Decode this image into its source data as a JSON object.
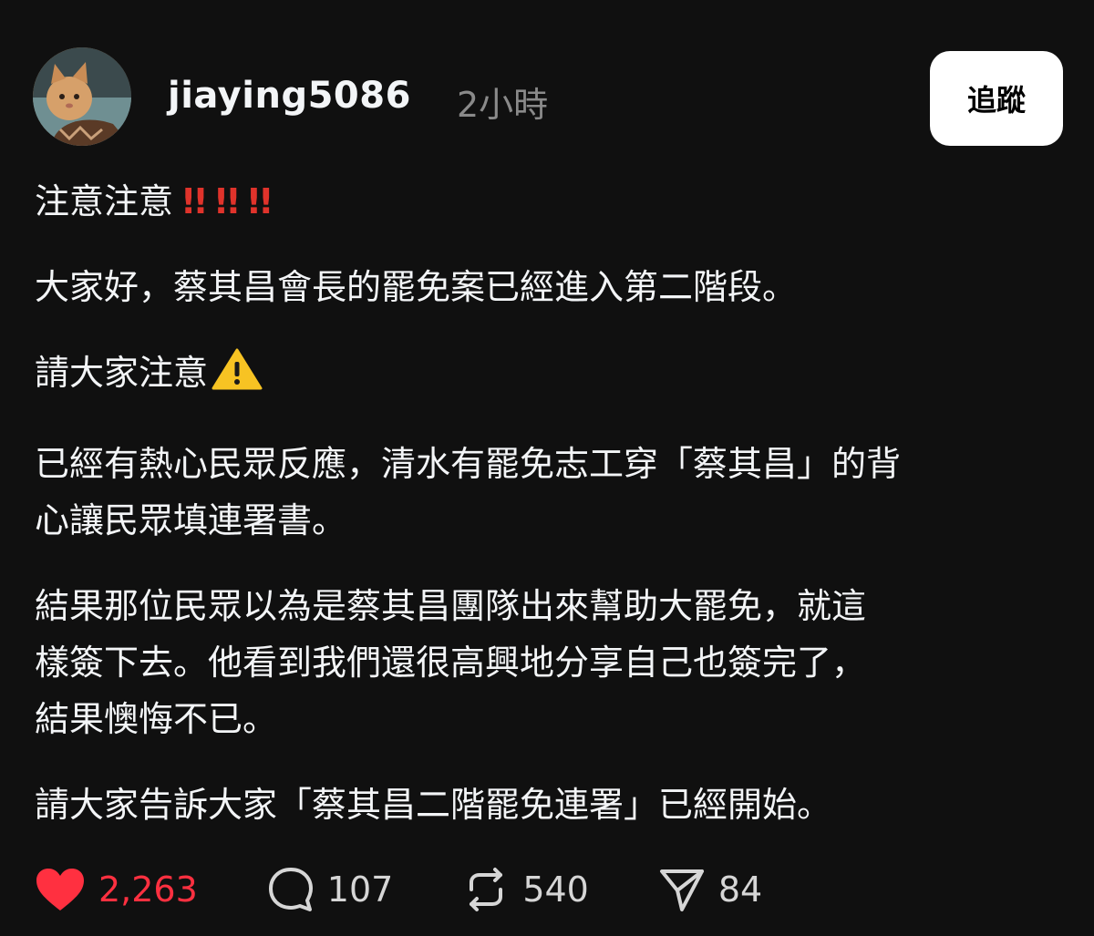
{
  "post": {
    "username": "jiaying5086",
    "timestamp": "2小時",
    "follow_label": "追蹤",
    "paragraphs": [
      "注意注意",
      "大家好，蔡其昌會長的罷免案已經進入第二階段。",
      "請大家注意",
      "已經有熱心民眾反應，清水有罷免志工穿「蔡其昌」的背\n心讓民眾填連署書。",
      "結果那位民眾以為是蔡其昌團隊出來幫助大罷免，就這\n樣簽下去。他看到我們還很高興地分享自己也簽完了，\n結果懊悔不已。",
      "請大家告訴大家「蔡其昌二階罷免連署」已經開始。"
    ],
    "exclaim": "!! !! !!",
    "icons": {
      "avatar": "cat-avatar-icon",
      "warning": "warning-icon",
      "like": "heart-icon",
      "comment": "comment-icon",
      "repost": "repost-icon",
      "share": "send-icon"
    }
  },
  "actions": {
    "likes": "2,263",
    "comments": "107",
    "reposts": "540",
    "shares": "84"
  },
  "colors": {
    "background": "#101010",
    "text": "#f3f5f7",
    "muted": "#8a8a8a",
    "like": "#ff3040",
    "exclaim": "#e0332b",
    "follow_bg": "#ffffff"
  }
}
